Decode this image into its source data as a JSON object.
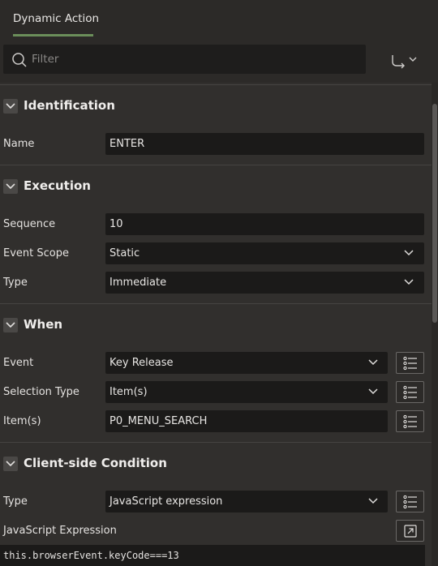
{
  "tabs": [
    {
      "label": "Dynamic Action",
      "active": true
    }
  ],
  "filter": {
    "placeholder": "Filter",
    "value": ""
  },
  "sections": {
    "identification": {
      "title": "Identification",
      "name_label": "Name",
      "name_value": "ENTER"
    },
    "execution": {
      "title": "Execution",
      "sequence_label": "Sequence",
      "sequence_value": "10",
      "scope_label": "Event Scope",
      "scope_value": "Static",
      "type_label": "Type",
      "type_value": "Immediate"
    },
    "when": {
      "title": "When",
      "event_label": "Event",
      "event_value": "Key Release",
      "seltype_label": "Selection Type",
      "seltype_value": "Item(s)",
      "items_label": "Item(s)",
      "items_value": "P0_MENU_SEARCH"
    },
    "condition": {
      "title": "Client-side Condition",
      "type_label": "Type",
      "type_value": "JavaScript expression",
      "js_label": "JavaScript Expression",
      "js_value": "this.browserEvent.keyCode===13"
    }
  },
  "colors": {
    "background": "#2c2a28",
    "panel": "#312f2d",
    "field": "#1b1a19",
    "tab_accent": "#6b8e5a"
  },
  "icons": [
    "search-icon",
    "goto-arrow-icon",
    "chevron-down-icon",
    "collapse-icon",
    "list-icon",
    "expand-icon"
  ]
}
